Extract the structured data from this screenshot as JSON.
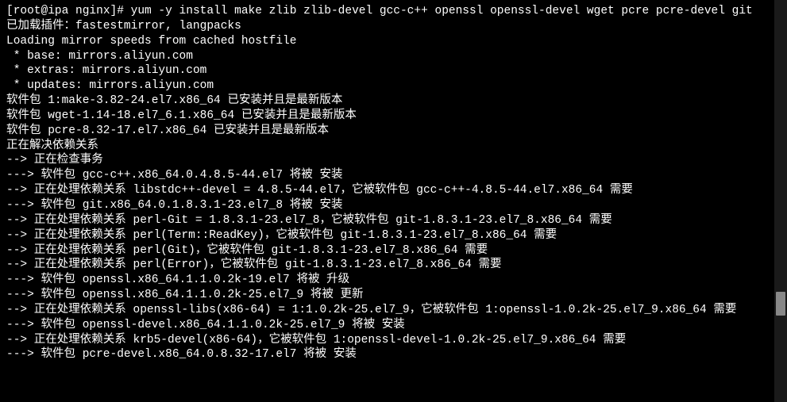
{
  "terminal": {
    "lines": [
      "[root@ipa nginx]# yum -y install make zlib zlib-devel gcc-c++ openssl openssl-devel wget pcre pcre-devel git",
      "已加载插件：fastestmirror, langpacks",
      "Loading mirror speeds from cached hostfile",
      " * base: mirrors.aliyun.com",
      " * extras: mirrors.aliyun.com",
      " * updates: mirrors.aliyun.com",
      "软件包 1:make-3.82-24.el7.x86_64 已安装并且是最新版本",
      "软件包 wget-1.14-18.el7_6.1.x86_64 已安装并且是最新版本",
      "软件包 pcre-8.32-17.el7.x86_64 已安装并且是最新版本",
      "正在解决依赖关系",
      "--> 正在检查事务",
      "---> 软件包 gcc-c++.x86_64.0.4.8.5-44.el7 将被 安装",
      "--> 正在处理依赖关系 libstdc++-devel = 4.8.5-44.el7，它被软件包 gcc-c++-4.8.5-44.el7.x86_64 需要",
      "---> 软件包 git.x86_64.0.1.8.3.1-23.el7_8 将被 安装",
      "--> 正在处理依赖关系 perl-Git = 1.8.3.1-23.el7_8，它被软件包 git-1.8.3.1-23.el7_8.x86_64 需要",
      "--> 正在处理依赖关系 perl(Term::ReadKey)，它被软件包 git-1.8.3.1-23.el7_8.x86_64 需要",
      "--> 正在处理依赖关系 perl(Git)，它被软件包 git-1.8.3.1-23.el7_8.x86_64 需要",
      "--> 正在处理依赖关系 perl(Error)，它被软件包 git-1.8.3.1-23.el7_8.x86_64 需要",
      "---> 软件包 openssl.x86_64.1.1.0.2k-19.el7 将被 升级",
      "---> 软件包 openssl.x86_64.1.1.0.2k-25.el7_9 将被 更新",
      "--> 正在处理依赖关系 openssl-libs(x86-64) = 1:1.0.2k-25.el7_9，它被软件包 1:openssl-1.0.2k-25.el7_9.x86_64 需要",
      "---> 软件包 openssl-devel.x86_64.1.1.0.2k-25.el7_9 将被 安装",
      "--> 正在处理依赖关系 krb5-devel(x86-64)，它被软件包 1:openssl-devel-1.0.2k-25.el7_9.x86_64 需要",
      "---> 软件包 pcre-devel.x86_64.0.8.32-17.el7 将被 安装"
    ]
  }
}
